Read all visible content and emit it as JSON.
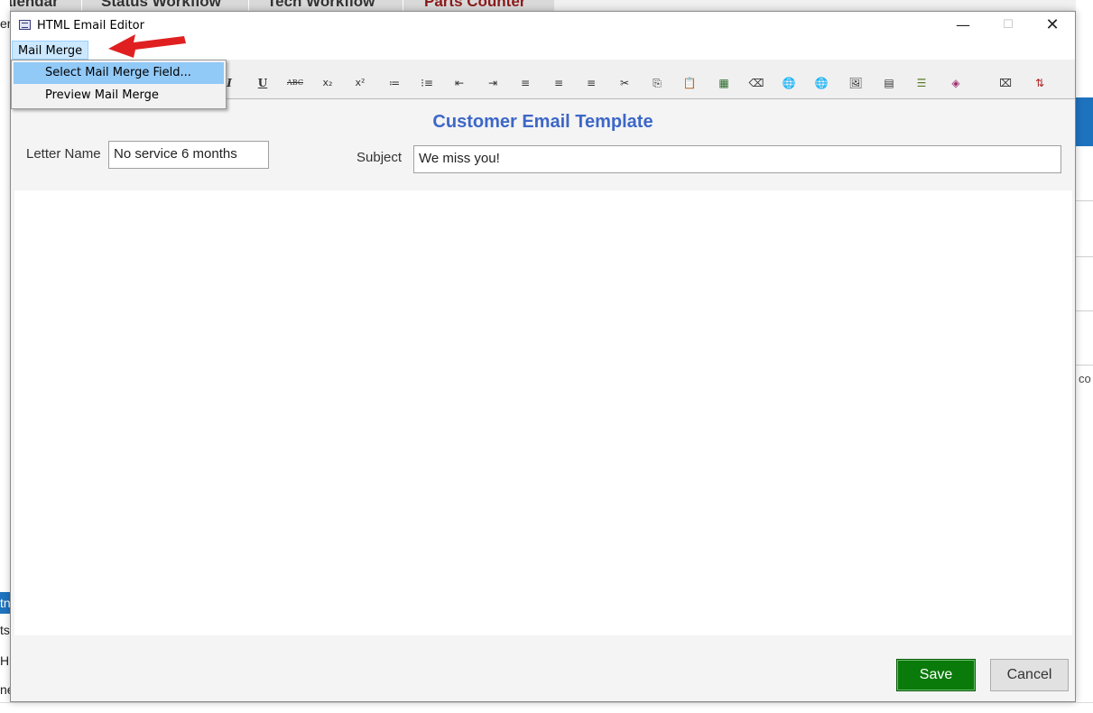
{
  "background": {
    "tabs": [
      "Calendar",
      "Status Workflow",
      "Tech Workflow",
      "Parts Counter"
    ],
    "right_fragment": "co",
    "left_fragments": [
      "en",
      "tn",
      "ts",
      "H",
      "ne"
    ]
  },
  "window": {
    "title": "HTML Email Editor",
    "minimize": "—",
    "maximize": "☐",
    "close": "✕"
  },
  "menubar": {
    "mail_merge": "Mail Merge"
  },
  "dropdown": {
    "items": [
      "Select Mail Merge Field...",
      "Preview Mail Merge"
    ]
  },
  "toolbar": {
    "icons": [
      {
        "name": "italic-icon",
        "glyph": "I"
      },
      {
        "name": "underline-icon",
        "glyph": "U"
      },
      {
        "name": "strikethrough-icon",
        "glyph": "ABC"
      },
      {
        "name": "subscript-icon",
        "glyph": "x₂"
      },
      {
        "name": "superscript-icon",
        "glyph": "x²"
      },
      {
        "name": "numbered-list-icon",
        "glyph": "≔"
      },
      {
        "name": "bullet-list-icon",
        "glyph": "⁝≡"
      },
      {
        "name": "outdent-icon",
        "glyph": "⇤"
      },
      {
        "name": "indent-icon",
        "glyph": "⇥"
      },
      {
        "name": "align-left-icon",
        "glyph": "≡"
      },
      {
        "name": "align-center-icon",
        "glyph": "≡"
      },
      {
        "name": "align-right-icon",
        "glyph": "≡"
      },
      {
        "name": "cut-icon",
        "glyph": "✂"
      },
      {
        "name": "copy-icon",
        "glyph": "⎘"
      },
      {
        "name": "paste-icon",
        "glyph": "📋"
      },
      {
        "name": "select-all-icon",
        "glyph": "▦"
      },
      {
        "name": "eraser-icon",
        "glyph": "⌫"
      },
      {
        "name": "insert-link-icon",
        "glyph": "🌐"
      },
      {
        "name": "remove-link-icon",
        "glyph": "🌐"
      },
      {
        "name": "insert-image-icon",
        "glyph": "🖼"
      },
      {
        "name": "insert-table-icon",
        "glyph": "▤"
      },
      {
        "name": "horizontal-rule-icon",
        "glyph": "☰"
      },
      {
        "name": "special-char-icon",
        "glyph": "◈"
      },
      {
        "name": "source-view-icon",
        "glyph": "⌧"
      },
      {
        "name": "find-replace-icon",
        "glyph": "⇅"
      }
    ]
  },
  "form": {
    "page_title": "Customer Email Template",
    "letter_name_label": "Letter Name",
    "letter_name_value": "No service 6 months",
    "subject_label": "Subject",
    "subject_value": "We miss you!"
  },
  "buttons": {
    "save": "Save",
    "cancel": "Cancel"
  },
  "colors": {
    "title_blue": "#3d67c7",
    "save_green": "#0a7a0a",
    "menu_highlight": "#91c9f7",
    "arrow_red": "#e02020"
  }
}
